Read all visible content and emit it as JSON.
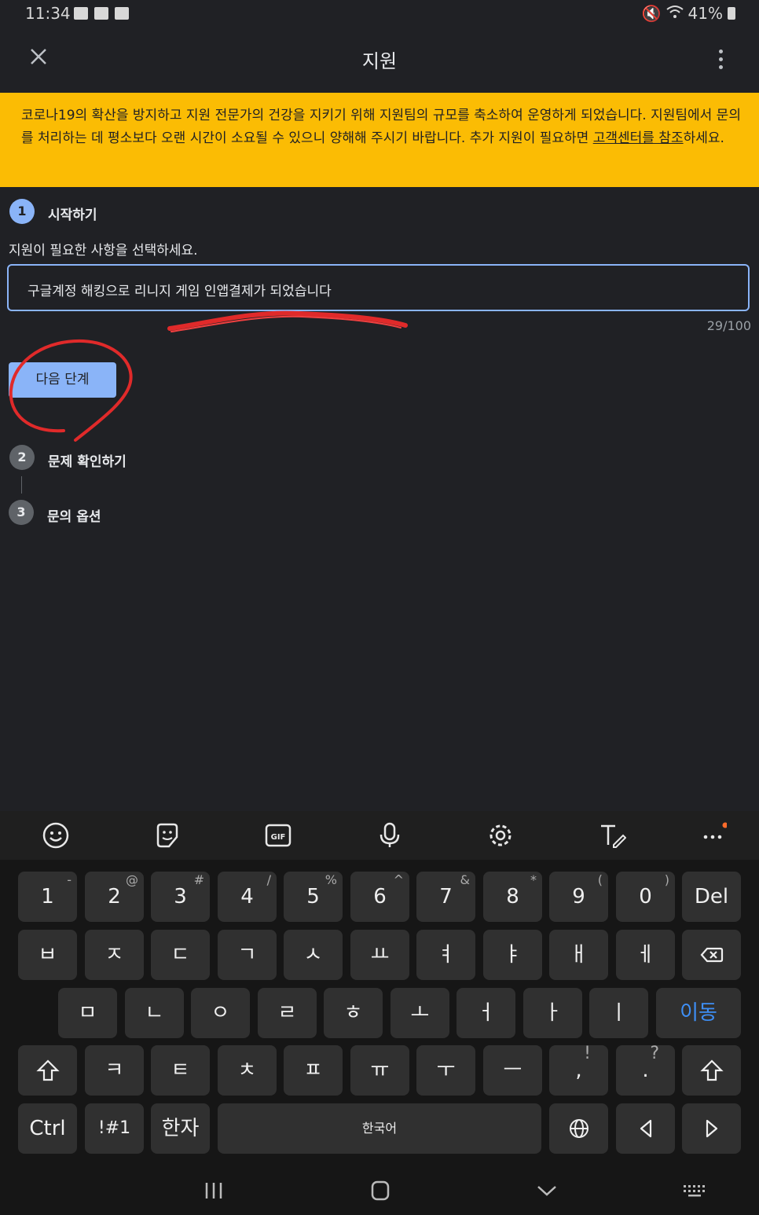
{
  "status_bar": {
    "time": "11:34",
    "battery": "41%"
  },
  "app_bar": {
    "title": "지원"
  },
  "banner": {
    "text": "코로나19의 확산을 방지하고 지원 전문가의 건강을 지키기 위해 지원팀의 규모를 축소하여 운영하게 되었습니다. 지원팀에서 문의를 처리하는 데 평소보다 오랜 시간이 소요될 수 있으니 양해해 주시기 바랍니다. 추가 지원이 필요하면 ",
    "link": "고객센터를 참조",
    "suffix": "하세요."
  },
  "stepper": {
    "steps": [
      {
        "number": "1",
        "label": "시작하기"
      },
      {
        "number": "2",
        "label": "문제 확인하기"
      },
      {
        "number": "3",
        "label": "문의 옵션"
      }
    ],
    "prompt": "지원이 필요한 사항을 선택하세요.",
    "input_value": "구글계정 해킹으로 리니지 게임  인앱결제가 되었습니다",
    "counter": "29/100",
    "next_button": "다음 단계"
  },
  "keyboard": {
    "toolbar_icons": [
      "emoji-icon",
      "sticker-icon",
      "gif-icon",
      "mic-icon",
      "settings-icon",
      "text-edit-icon",
      "more-icon"
    ],
    "gif_label": "GIF",
    "row1": [
      {
        "k": "1",
        "s": "-"
      },
      {
        "k": "2",
        "s": "@"
      },
      {
        "k": "3",
        "s": "#"
      },
      {
        "k": "4",
        "s": "/"
      },
      {
        "k": "5",
        "s": "%"
      },
      {
        "k": "6",
        "s": "^"
      },
      {
        "k": "7",
        "s": "&"
      },
      {
        "k": "8",
        "s": "*"
      },
      {
        "k": "9",
        "s": "("
      },
      {
        "k": "0",
        "s": ")"
      },
      {
        "k": "Del",
        "s": ""
      }
    ],
    "row2": [
      "ㅂ",
      "ㅈ",
      "ㄷ",
      "ㄱ",
      "ㅅ",
      "ㅛ",
      "ㅕ",
      "ㅑ",
      "ㅐ",
      "ㅔ"
    ],
    "row3": [
      "ㅁ",
      "ㄴ",
      "ㅇ",
      "ㄹ",
      "ㅎ",
      "ㅗ",
      "ㅓ",
      "ㅏ",
      "ㅣ"
    ],
    "move_label": "이동",
    "row4": [
      "ㅋ",
      "ㅌ",
      "ㅊ",
      "ㅍ",
      "ㅠ",
      "ㅜ",
      "ㅡ"
    ],
    "row4_punct": [
      {
        "k": ",",
        "s": "!"
      },
      {
        "k": ".",
        "s": "?"
      }
    ],
    "ctrl": "Ctrl",
    "sym": "!#1",
    "hanja": "한자",
    "space": "한국어"
  }
}
